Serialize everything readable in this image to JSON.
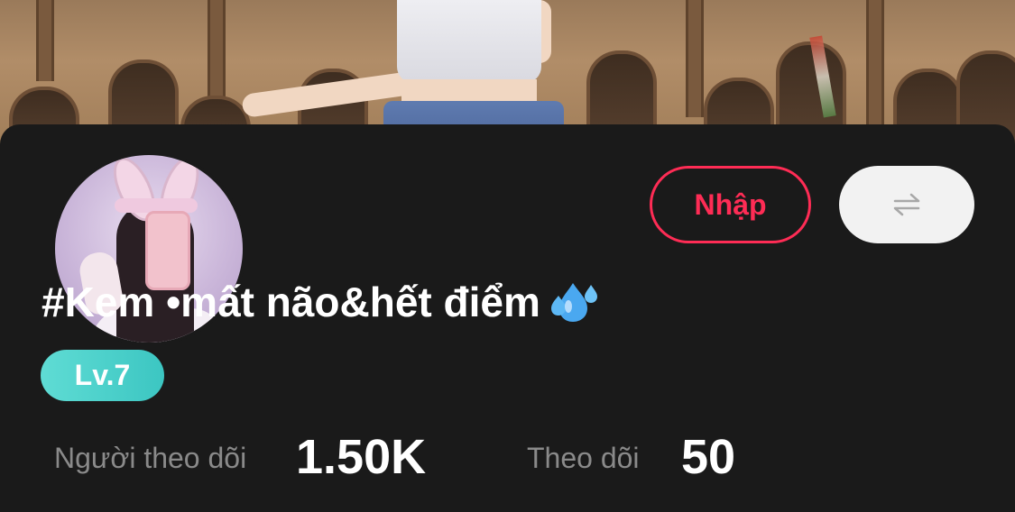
{
  "profile": {
    "name": "#Kem •mất não&hết điểm",
    "level": "Lv.7",
    "buttons": {
      "import_label": "Nhập",
      "switch_icon": "swap-arrows-icon"
    },
    "stats": [
      {
        "label": "Người theo dõi",
        "value": "1.50K"
      },
      {
        "label": "Theo dõi",
        "value": "50"
      }
    ]
  },
  "colors": {
    "accent": "#fe2c55",
    "background": "#1a1a1a",
    "level_badge": "#4fd1cb",
    "muted_text": "#8a8a8a"
  }
}
